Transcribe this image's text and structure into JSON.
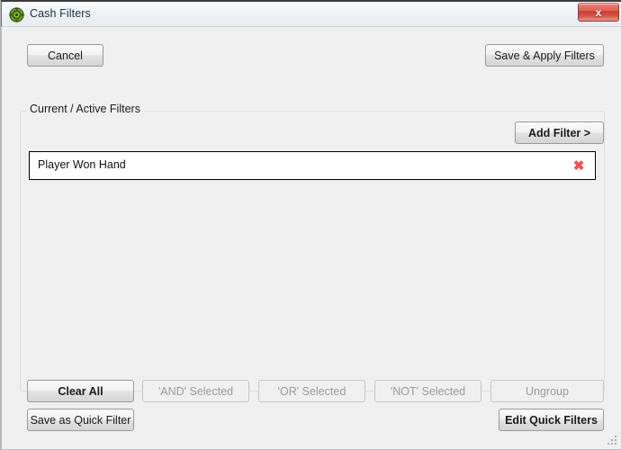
{
  "window": {
    "title": "Cash Filters",
    "icon": "poker-chip-icon",
    "close_label": "x",
    "accent_close": "#c83a2c",
    "background": "#f0f0f0"
  },
  "toolbar": {
    "cancel_label": "Cancel",
    "save_apply_label": "Save & Apply Filters"
  },
  "group": {
    "label": "Current / Active Filters",
    "add_filter_label": "Add Filter >"
  },
  "filters": {
    "rows": [
      {
        "label": "Player Won Hand",
        "delete_icon": "red-x-icon",
        "delete_glyph": "✖",
        "delete_color": "#f0524d"
      }
    ]
  },
  "actions": {
    "clear_all": {
      "label": "Clear All",
      "enabled": true
    },
    "and_selected": {
      "label": "'AND' Selected",
      "enabled": false
    },
    "or_selected": {
      "label": "'OR' Selected",
      "enabled": false
    },
    "not_selected": {
      "label": "'NOT' Selected",
      "enabled": false
    },
    "ungroup": {
      "label": "Ungroup",
      "enabled": false
    }
  },
  "footer": {
    "save_quick_filter_label": "Save as Quick Filter",
    "edit_quick_filters_label": "Edit Quick Filters"
  }
}
